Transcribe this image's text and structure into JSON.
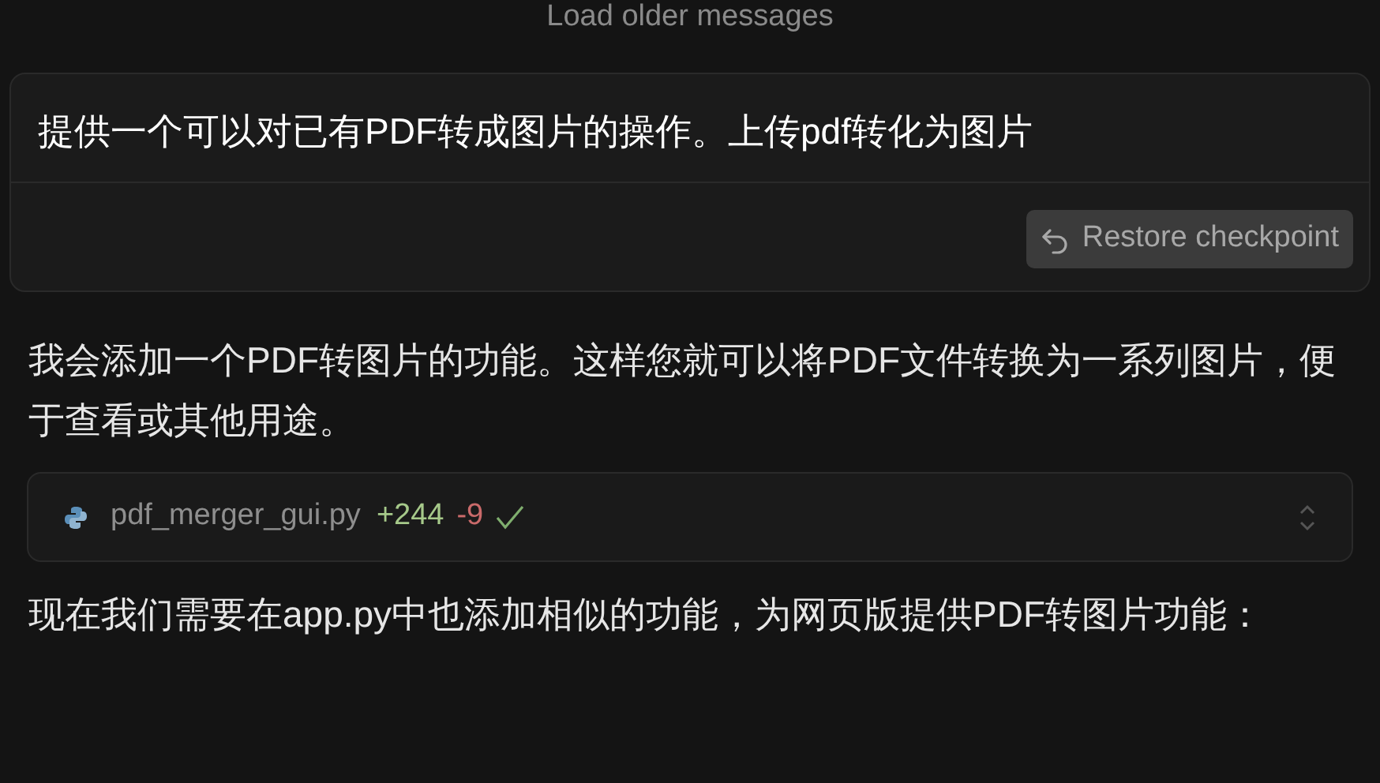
{
  "load_more": {
    "label": "Load older messages"
  },
  "user_message": {
    "text": "提供一个可以对已有PDF转成图片的操作。上传pdf转化为图片",
    "restore_button": "Restore checkpoint"
  },
  "assistant": [
    {
      "kind": "text",
      "text": "我会添加一个PDF转图片的功能。这样您就可以将PDF文件转换为一系列图片，便于查看或其他用途。"
    },
    {
      "kind": "file",
      "filename": "pdf_merger_gui.py",
      "added": "+244",
      "removed": "-9",
      "applied": true
    },
    {
      "kind": "text",
      "text": "现在我们需要在app.py中也添加相似的功能，为网页版提供PDF转图片功能："
    }
  ]
}
